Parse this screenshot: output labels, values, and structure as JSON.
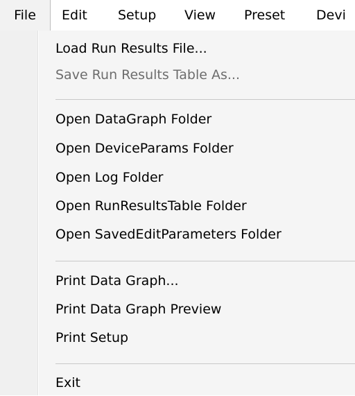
{
  "menubar": {
    "items": [
      {
        "label": "File",
        "active": true
      },
      {
        "label": "Edit"
      },
      {
        "label": "Setup"
      },
      {
        "label": "View"
      },
      {
        "label": "Preset"
      },
      {
        "label": "Devi"
      }
    ]
  },
  "file_menu": {
    "items": [
      {
        "label": "Load Run Results File...",
        "enabled": true
      },
      {
        "label": "Save Run Results Table As...",
        "enabled": false
      },
      {
        "label": "Open DataGraph Folder",
        "enabled": true
      },
      {
        "label": "Open DeviceParams Folder",
        "enabled": true
      },
      {
        "label": "Open Log Folder",
        "enabled": true
      },
      {
        "label": "Open RunResultsTable Folder",
        "enabled": true
      },
      {
        "label": "Open SavedEditParameters Folder",
        "enabled": true
      },
      {
        "label": "Print Data Graph...",
        "enabled": true
      },
      {
        "label": "Print Data Graph Preview",
        "enabled": true
      },
      {
        "label": "Print Setup",
        "enabled": true
      },
      {
        "label": "Exit",
        "enabled": true
      }
    ]
  },
  "colors": {
    "menu_background": "#f5f5f5",
    "disabled_text": "#6d6d6d",
    "separator": "#c8c8c8"
  }
}
